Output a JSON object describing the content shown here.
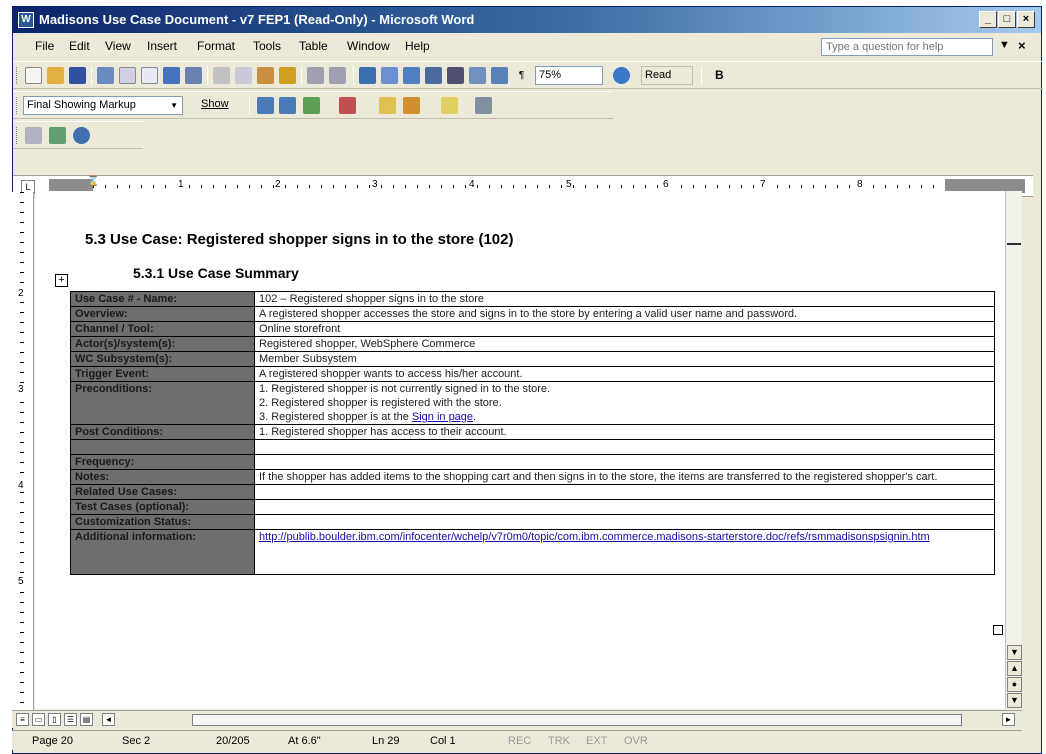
{
  "window": {
    "title": "Madisons Use Case Document - v7 FEP1 (Read-Only) - Microsoft Word",
    "buttons": {
      "minimize": "_",
      "maximize": "□",
      "close": "×"
    }
  },
  "menu": {
    "items": [
      "File",
      "Edit",
      "View",
      "Insert",
      "Format",
      "Tools",
      "Table",
      "Window",
      "Help"
    ],
    "help_placeholder": "Type a question for help",
    "close_doc": "×"
  },
  "toolbar": {
    "zoom": "75%",
    "read_button": "Read",
    "bold": "B",
    "pilcrow": "¶"
  },
  "reviewing": {
    "markup_mode": "Final Showing Markup",
    "show_label": "Show"
  },
  "ruler": {
    "numbers": [
      "1",
      "2",
      "3",
      "4",
      "5",
      "6",
      "7",
      "8"
    ],
    "vnumbers": [
      "2",
      "3",
      "4",
      "5"
    ]
  },
  "document": {
    "heading1": "5.3  Use Case:  Registered shopper signs in to the store (102)",
    "heading2": "5.3.1  Use Case Summary",
    "rows": [
      {
        "label": "Use Case # - Name:",
        "lines": [
          "102 – Registered shopper signs in to the store"
        ]
      },
      {
        "label": "Overview:",
        "lines": [
          "A registered shopper accesses the store and signs in to the store by entering a valid user name and password."
        ]
      },
      {
        "label": "Channel / Tool:",
        "lines": [
          "Online storefront"
        ]
      },
      {
        "label": "Actor(s)/system(s):",
        "lines": [
          "Registered shopper, WebSphere Commerce"
        ]
      },
      {
        "label": "WC Subsystem(s):",
        "lines": [
          "Member Subsystem"
        ]
      },
      {
        "label": "Trigger Event:",
        "lines": [
          "A registered shopper wants to access his/her account."
        ]
      },
      {
        "label": "Preconditions:",
        "lines": [
          "1. Registered shopper is not currently signed in to the store.",
          "2. Registered shopper is registered with the store."
        ],
        "link_line": {
          "prefix": "3. Registered shopper is at the ",
          "link": "Sign in page",
          "suffix": "."
        }
      },
      {
        "label": "Post Conditions:",
        "lines": [
          "1. Registered shopper has access to their account."
        ]
      },
      {
        "label": "",
        "lines": [
          ""
        ]
      },
      {
        "label": "Frequency:",
        "lines": [
          ""
        ]
      },
      {
        "label": "Notes:",
        "lines": [
          "If the shopper has added items to the shopping cart and then signs in to the store, the items are transferred to the registered shopper's cart."
        ]
      },
      {
        "label": "Related Use Cases:",
        "lines": [
          ""
        ]
      },
      {
        "label": "Test Cases (optional):",
        "lines": [
          ""
        ]
      },
      {
        "label": "Customization Status:",
        "lines": [
          ""
        ]
      },
      {
        "label": "Additional information:",
        "link": "http://publib.boulder.ibm.com/infocenter/wchelp/v7r0m0/topic/com.ibm.commerce.madisons-starterstore.doc/refs/rsmmadisonspsignin.htm"
      }
    ]
  },
  "status": {
    "page": "Page 20",
    "sec": "Sec 2",
    "pages": "20/205",
    "at": "At 6.6\"",
    "ln": "Ln 29",
    "col": "Col 1",
    "rec": "REC",
    "trk": "TRK",
    "ext": "EXT",
    "ovr": "OVR"
  }
}
